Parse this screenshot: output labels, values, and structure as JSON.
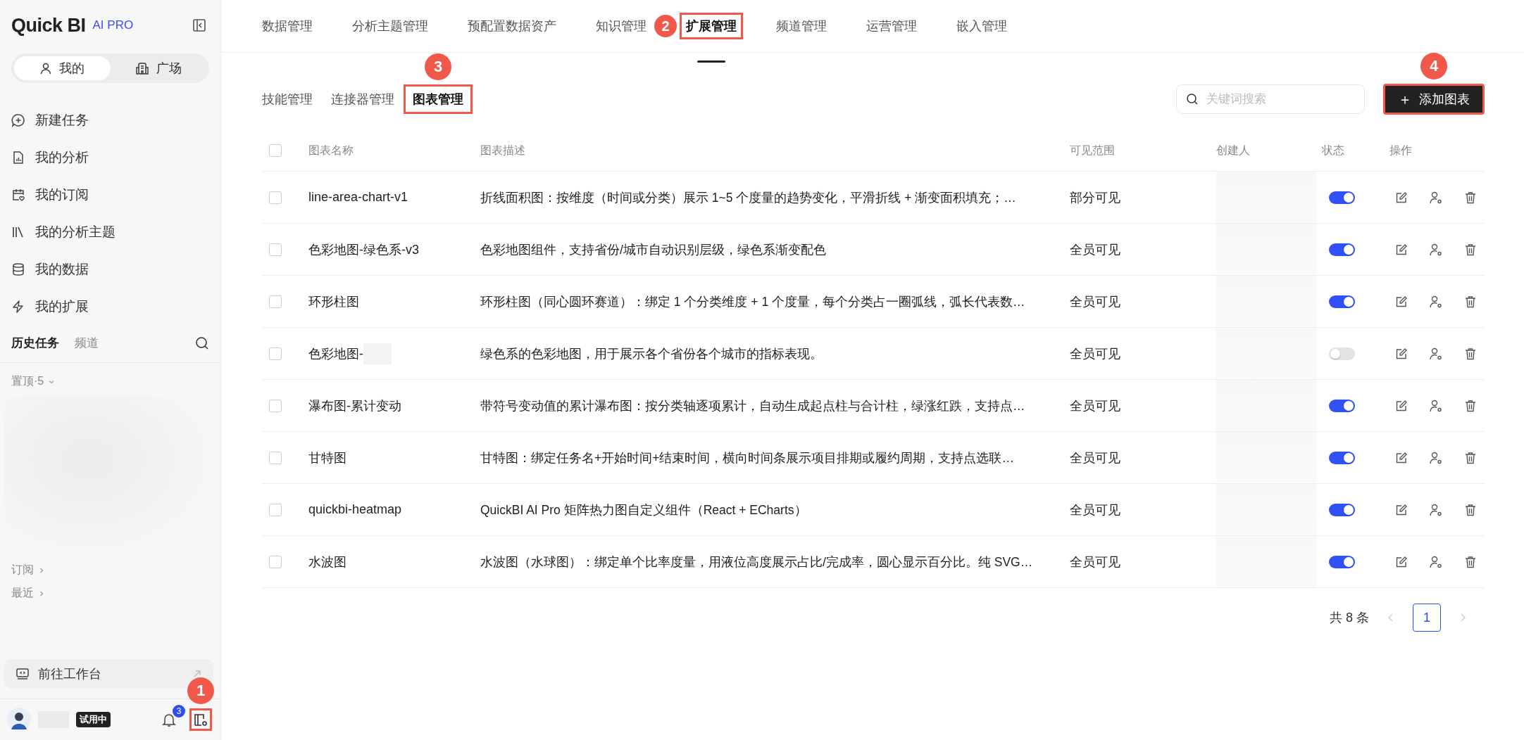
{
  "sidebar": {
    "logo": "Quick BI",
    "logo_badge": "AI PRO",
    "switch": [
      {
        "label": "我的",
        "selected": true,
        "kind": "person"
      },
      {
        "label": "广场",
        "selected": false,
        "kind": "building"
      }
    ],
    "menu": [
      {
        "label": "新建任务",
        "kind": "chat-plus"
      },
      {
        "label": "我的分析",
        "kind": "report"
      },
      {
        "label": "我的订阅",
        "kind": "calendar"
      },
      {
        "label": "我的分析主题",
        "kind": "books"
      },
      {
        "label": "我的数据",
        "kind": "database"
      },
      {
        "label": "我的扩展",
        "kind": "bolt"
      }
    ],
    "history_tabs": [
      {
        "label": "历史任务",
        "selected": true
      },
      {
        "label": "频道",
        "selected": false
      }
    ],
    "pinned": "置顶·5",
    "links": [
      "订阅",
      "最近"
    ],
    "workbench": "前往工作台",
    "user": {
      "badge": "试用中",
      "notifications": "3",
      "settings_callout": "1"
    }
  },
  "top_tabs": [
    {
      "label": "数据管理",
      "selected": false
    },
    {
      "label": "分析主题管理",
      "selected": false
    },
    {
      "label": "预配置数据资产",
      "selected": false
    },
    {
      "label": "知识管理",
      "selected": false
    },
    {
      "label": "扩展管理",
      "selected": true,
      "callout": "2"
    },
    {
      "label": "频道管理",
      "selected": false
    },
    {
      "label": "运营管理",
      "selected": false
    },
    {
      "label": "嵌入管理",
      "selected": false
    }
  ],
  "sub_tabs": [
    {
      "label": "技能管理",
      "selected": false
    },
    {
      "label": "连接器管理",
      "selected": false
    },
    {
      "label": "图表管理",
      "selected": true,
      "callout": "3"
    }
  ],
  "search": {
    "placeholder": "关键词搜索"
  },
  "add_button": {
    "label": "添加图表",
    "icon": "＋",
    "callout": "4"
  },
  "table": {
    "select_all_checked": false,
    "columns": [
      "图表名称",
      "图表描述",
      "可见范围",
      "创建人",
      "状态",
      "操作"
    ],
    "rows": [
      {
        "name": "line-area-chart-v1",
        "description": "折线面积图：按维度（时间或分类）展示 1~5 个度量的趋势变化，平滑折线 + 渐变面积填充；…",
        "visibility": "部分可见",
        "checked": false,
        "on": true
      },
      {
        "name": "色彩地图-绿色系-v3",
        "description": "色彩地图组件，支持省份/城市自动识别层级，绿色系渐变配色",
        "visibility": "全员可见",
        "checked": false,
        "on": true
      },
      {
        "name": "环形柱图",
        "description": "环形柱图（同心圆环赛道）：绑定 1 个分类维度 + 1 个度量，每个分类占一圈弧线，弧长代表数…",
        "visibility": "全员可见",
        "checked": false,
        "on": true
      },
      {
        "name": "色彩地图-",
        "description": "绿色系的色彩地图，用于展示各个省份各个城市的指标表现。",
        "visibility": "全员可见",
        "checked": false,
        "on": false
      },
      {
        "name": "瀑布图-累计变动",
        "description": "带符号变动值的累计瀑布图：按分类轴逐项累计，自动生成起点柱与合计柱，绿涨红跌，支持点…",
        "visibility": "全员可见",
        "checked": false,
        "on": true
      },
      {
        "name": "甘特图",
        "description": "甘特图：绑定任务名+开始时间+结束时间，横向时间条展示项目排期或履约周期，支持点选联…",
        "visibility": "全员可见",
        "checked": false,
        "on": true
      },
      {
        "name": "quickbi-heatmap",
        "description": "QuickBI AI Pro 矩阵热力图自定义组件（React + ECharts）",
        "visibility": "全员可见",
        "checked": false,
        "on": true
      },
      {
        "name": "水波图",
        "description": "水波图（水球图）：绑定单个比率度量，用液位高度展示占比/完成率，圆心显示百分比。纯 SVG…",
        "visibility": "全员可见",
        "checked": false,
        "on": true
      }
    ]
  },
  "pagination": {
    "total": "共 8 条",
    "pages": [
      {
        "label": "1",
        "selected": true
      }
    ]
  }
}
